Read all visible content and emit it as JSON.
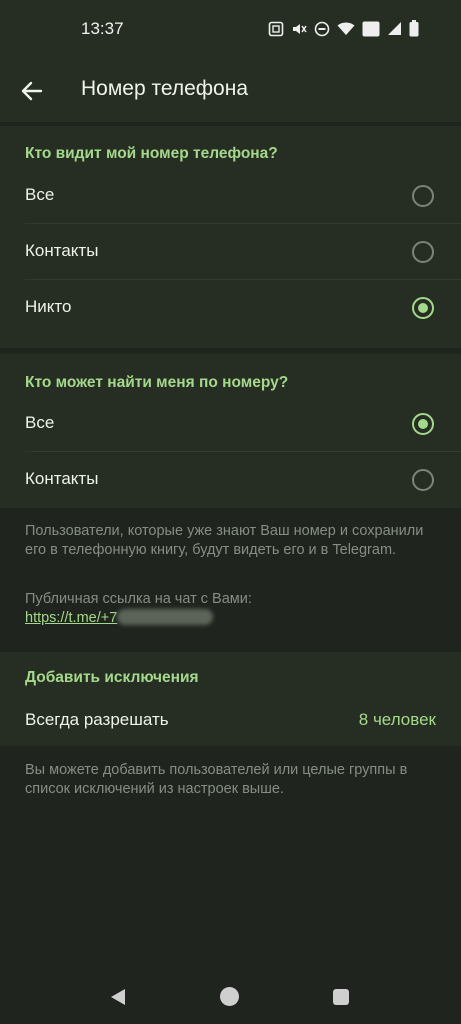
{
  "status_bar": {
    "time": "13:37",
    "icons": [
      "nfc-icon",
      "mute-icon",
      "dnd-icon",
      "wifi-icon",
      "volte-icon",
      "signal-icon",
      "battery-icon"
    ],
    "volte_text": "Vo LTE"
  },
  "header": {
    "title": "Номер телефона"
  },
  "who_sees": {
    "heading": "Кто видит мой номер телефона?",
    "options": [
      {
        "label": "Все",
        "selected": false
      },
      {
        "label": "Контакты",
        "selected": false
      },
      {
        "label": "Никто",
        "selected": true
      }
    ]
  },
  "who_finds": {
    "heading": "Кто может найти меня по номеру?",
    "options": [
      {
        "label": "Все",
        "selected": true
      },
      {
        "label": "Контакты",
        "selected": false
      }
    ],
    "hint": "Пользователи, которые уже знают Ваш номер и сохранили его в телефонную книгу, будут видеть его и в Telegram.",
    "link_caption": "Публичная ссылка на чат с Вами:",
    "link_text": "https://t.me/+7"
  },
  "exceptions": {
    "heading": "Добавить исключения",
    "always_allow_label": "Всегда разрешать",
    "always_allow_value": "8 человек",
    "footer": "Вы можете добавить пользователей или целые группы в список исключений из настроек выше."
  },
  "colors": {
    "accent": "#a4d88a",
    "background": "#1f251e",
    "surface": "#262e24"
  }
}
